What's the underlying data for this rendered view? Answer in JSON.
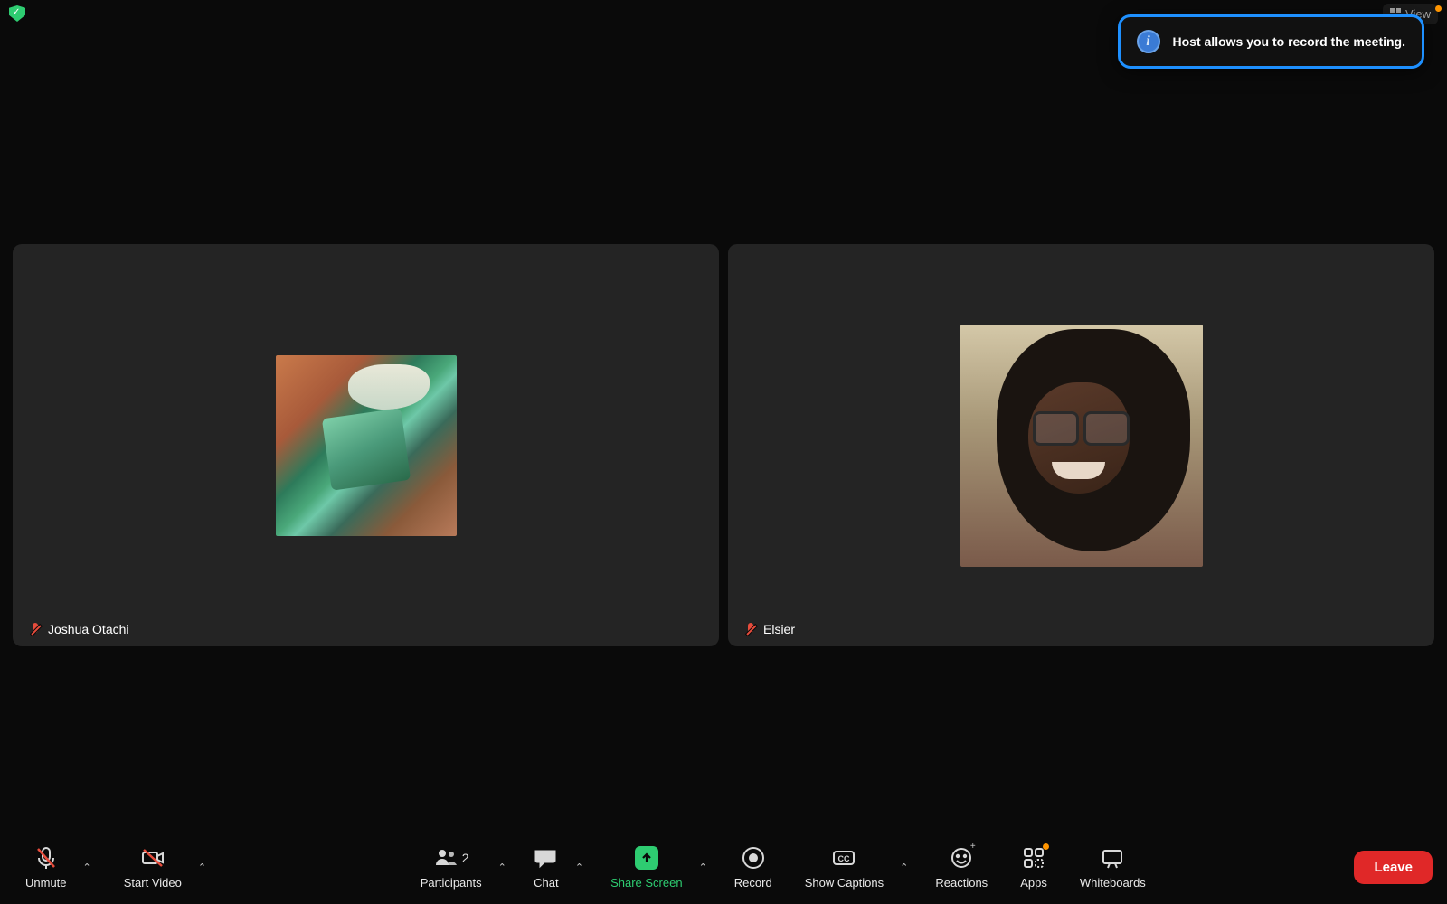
{
  "topbar": {
    "view_label": "View"
  },
  "notification": {
    "text": "Host allows you to record the meeting.",
    "info_glyph": "i"
  },
  "participants": [
    {
      "name": "Joshua Otachi",
      "muted": true
    },
    {
      "name": "Elsier",
      "muted": true
    }
  ],
  "toolbar": {
    "unmute": "Unmute",
    "start_video": "Start Video",
    "participants": "Participants",
    "participants_count": "2",
    "chat": "Chat",
    "share_screen": "Share Screen",
    "record": "Record",
    "show_captions": "Show Captions",
    "reactions": "Reactions",
    "apps": "Apps",
    "whiteboards": "Whiteboards",
    "leave": "Leave"
  },
  "colors": {
    "accent_green": "#2ecc71",
    "accent_red": "#e02828",
    "notification_border": "#1e90ff",
    "warn_orange": "#ff9500"
  }
}
